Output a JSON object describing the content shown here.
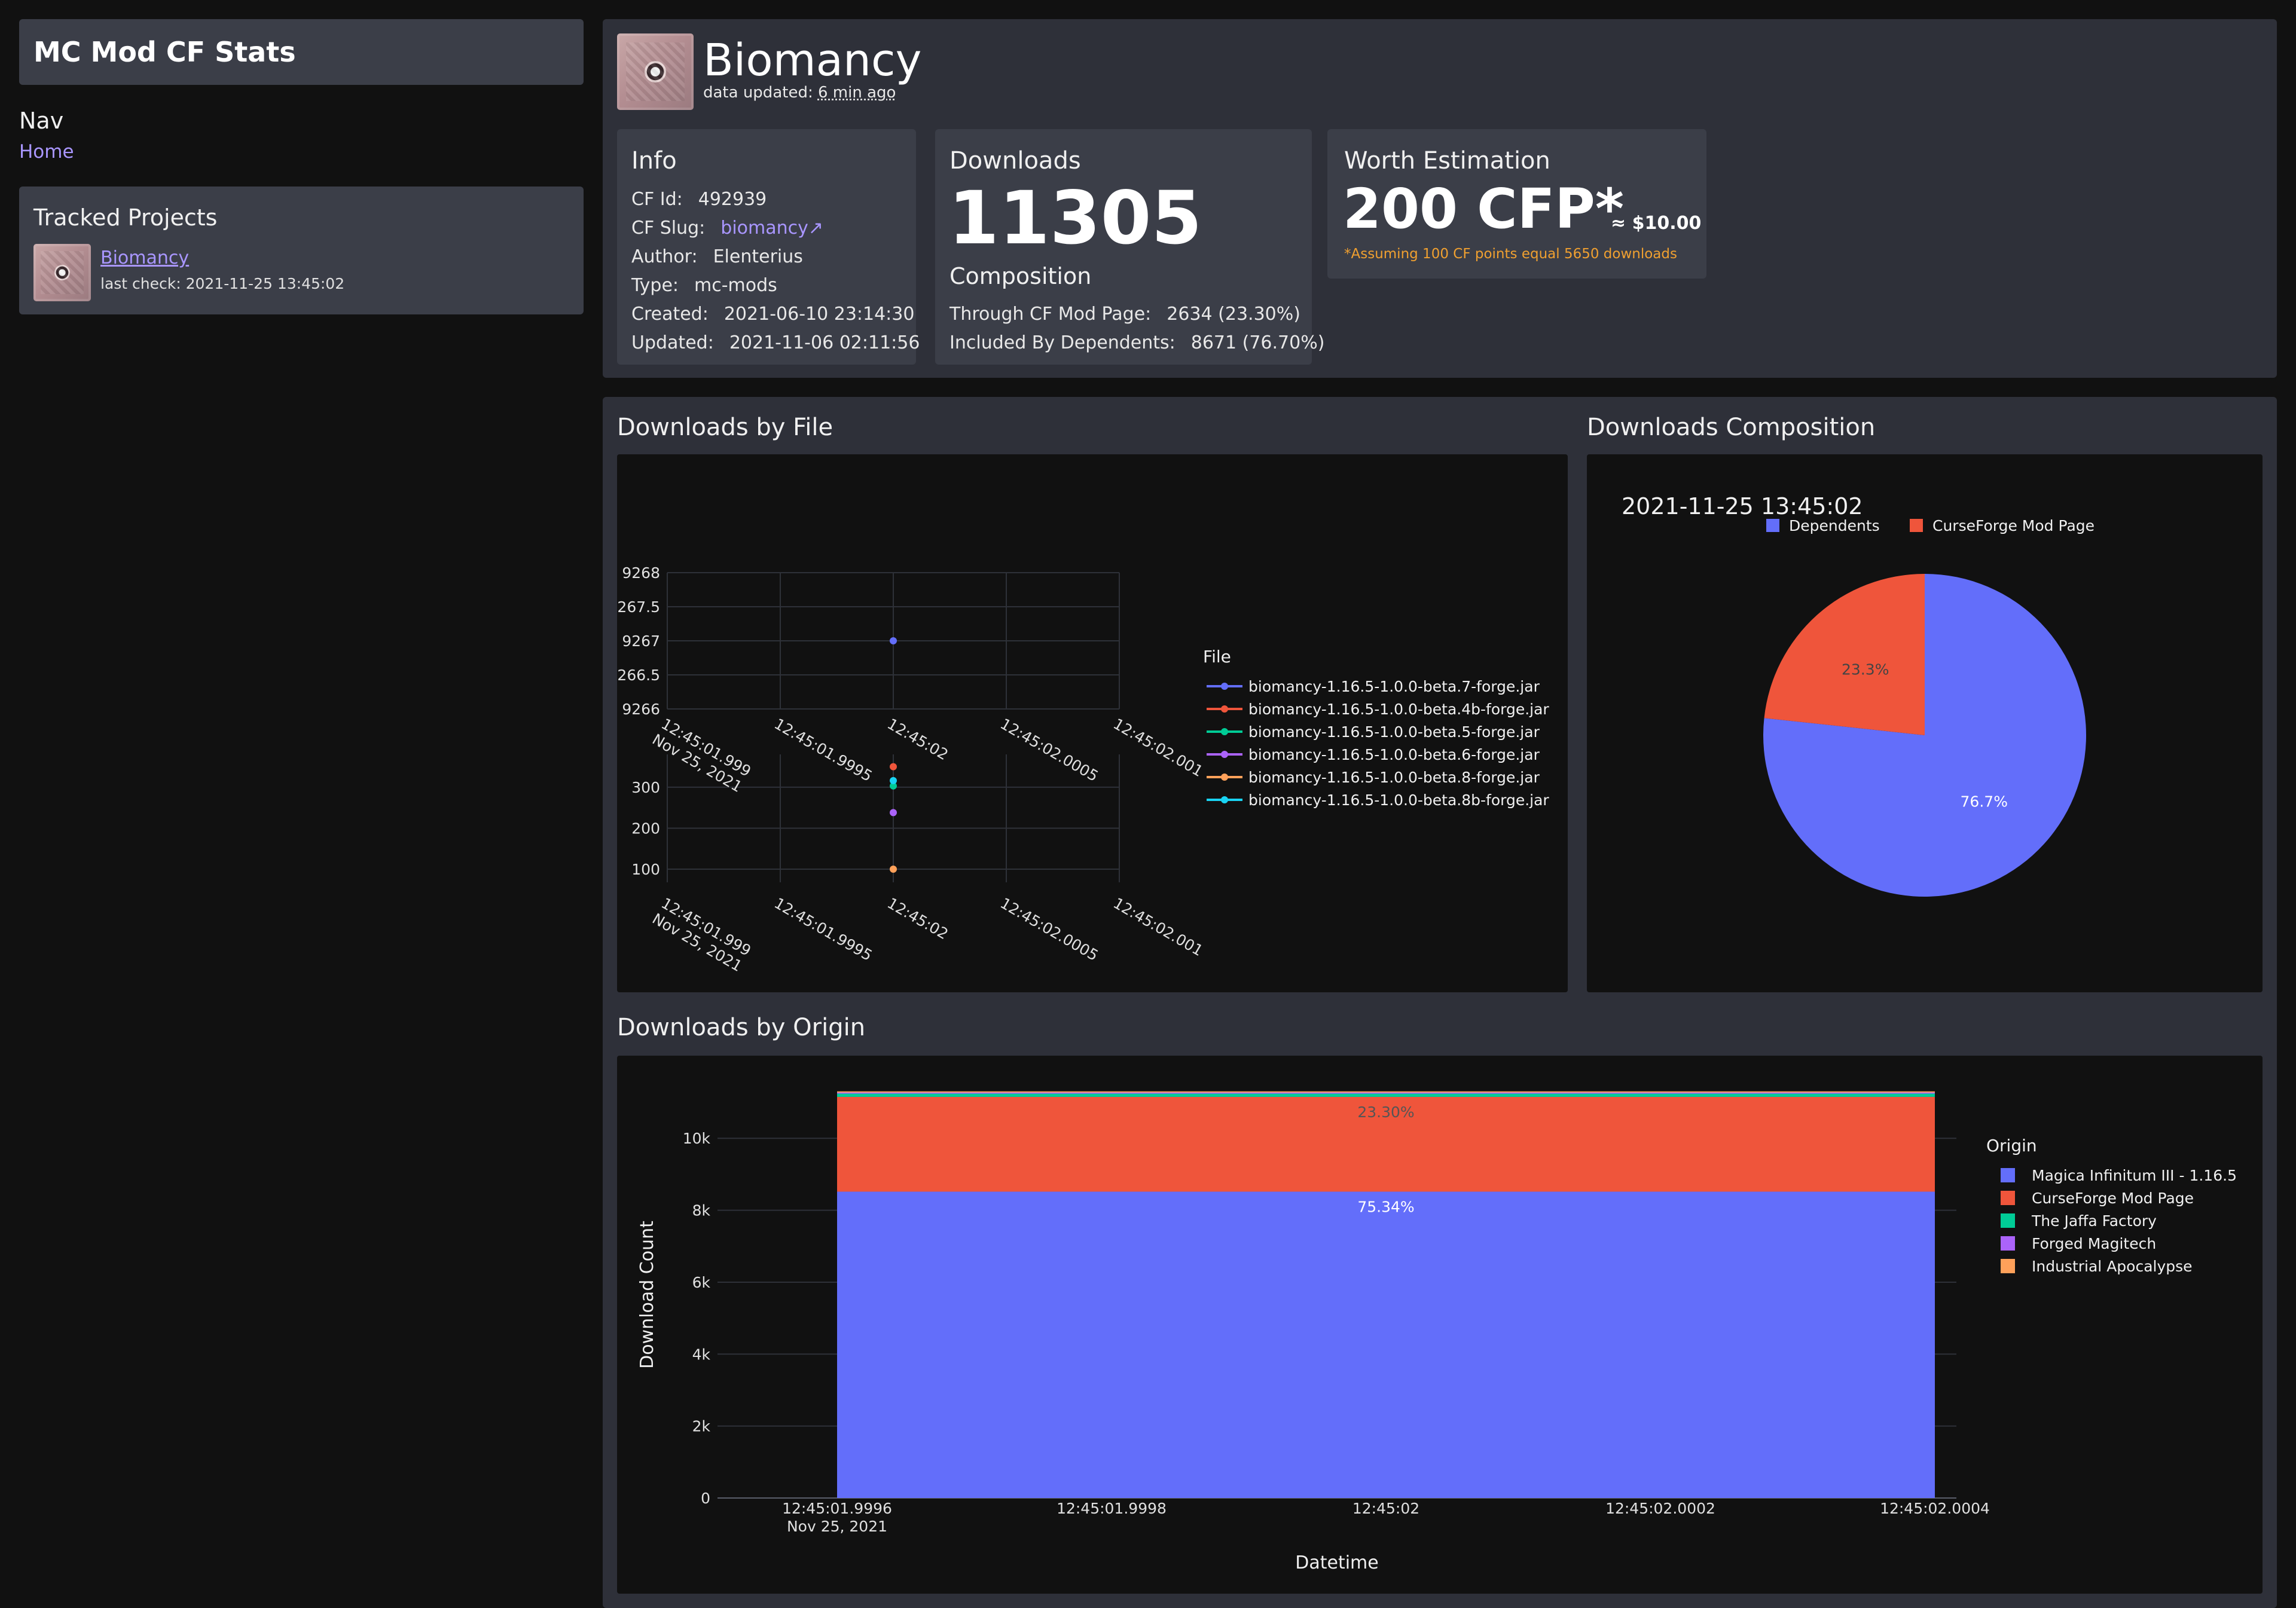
{
  "sidebar": {
    "title": "MC Mod CF Stats",
    "nav_heading": "Nav",
    "nav_home": "Home",
    "tracked_heading": "Tracked Projects",
    "tracked": [
      {
        "name": "Biomancy",
        "last_check": "last check: 2021-11-25 13:45:02"
      }
    ]
  },
  "header": {
    "title": "Biomancy",
    "updated_prefix": "data updated:",
    "updated_value": "6 min ago"
  },
  "info": {
    "heading": "Info",
    "cf_id_label": "CF Id:",
    "cf_id": "492939",
    "cf_slug_label": "CF Slug:",
    "cf_slug": "biomancy↗",
    "author_label": "Author:",
    "author": "Elenterius",
    "type_label": "Type:",
    "type": "mc-mods",
    "created_label": "Created:",
    "created": "2021-06-10 23:14:30",
    "updated_label": "Updated:",
    "updated": "2021-11-06 02:11:56"
  },
  "downloads": {
    "heading": "Downloads",
    "total": "11305",
    "composition_heading": "Composition",
    "through_label": "Through CF Mod Page:",
    "through_value": "2634 (23.30%)",
    "dependents_label": "Included By Dependents:",
    "dependents_value": "8671 (76.70%)"
  },
  "worth": {
    "heading": "Worth Estimation",
    "value": "200 CFP*",
    "usd": "≈ $10.00",
    "note": "*Assuming 100 CF points equal 5650 downloads"
  },
  "section_titles": {
    "by_file": "Downloads by File",
    "composition": "Downloads Composition",
    "by_origin": "Downloads by Origin"
  },
  "colors": {
    "blue": "#636efa",
    "red": "#ef553b",
    "green": "#00cc96",
    "purple": "#ab63fa",
    "orange": "#ffa15a",
    "cyan": "#19d3f3",
    "accent_link": "#a996ff",
    "note_orange": "#f0a030"
  },
  "chart_data": [
    {
      "type": "scatter",
      "title": "Downloads by File",
      "legend_title": "File",
      "legend_position": "right",
      "x_ticks": [
        "12:45:01.999\nNov 25, 2021",
        "12:45:01.9995",
        "12:45:02",
        "12:45:02.0005",
        "12:45:02.001"
      ],
      "upper_y_ticks": [
        "9268",
        "9,267.5",
        "9267",
        "9,266.5",
        "9266"
      ],
      "lower_y_ticks": [
        "300",
        "200",
        "100"
      ],
      "series": [
        {
          "name": "biomancy-1.16.5-1.0.0-beta.7-forge.jar",
          "x": "2021-11-25 12:45:02",
          "y": 9267
        },
        {
          "name": "biomancy-1.16.5-1.0.0-beta.4b-forge.jar",
          "x": "2021-11-25 12:45:02",
          "y": 350
        },
        {
          "name": "biomancy-1.16.5-1.0.0-beta.5-forge.jar",
          "x": "2021-11-25 12:45:02",
          "y": 303
        },
        {
          "name": "biomancy-1.16.5-1.0.0-beta.6-forge.jar",
          "x": "2021-11-25 12:45:02",
          "y": 238
        },
        {
          "name": "biomancy-1.16.5-1.0.0-beta.8-forge.jar",
          "x": "2021-11-25 12:45:02",
          "y": 100
        },
        {
          "name": "biomancy-1.16.5-1.0.0-beta.8b-forge.jar",
          "x": "2021-11-25 12:45:02",
          "y": 316
        }
      ]
    },
    {
      "type": "pie",
      "title": "2021-11-25 13:45:02",
      "legend_position": "top",
      "slices": [
        {
          "name": "Dependents",
          "value": 76.7,
          "label": "76.7%"
        },
        {
          "name": "CurseForge Mod Page",
          "value": 23.3,
          "label": "23.3%"
        }
      ]
    },
    {
      "type": "area",
      "title": "Downloads by Origin",
      "xlabel": "Datetime",
      "ylabel": "Download Count",
      "ylim": [
        0,
        11305
      ],
      "y_ticks": [
        "0",
        "2k",
        "4k",
        "6k",
        "8k",
        "10k"
      ],
      "x_ticks": [
        "12:45:01.9996\nNov 25, 2021",
        "12:45:01.9998",
        "12:45:02",
        "12:45:02.0002",
        "12:45:02.0004"
      ],
      "legend_title": "Origin",
      "legend_position": "right",
      "series": [
        {
          "name": "Magica Infinitum III - 1.16.5",
          "value": 8517,
          "label": "75.34%"
        },
        {
          "name": "CurseForge Mod Page",
          "value": 2634,
          "label": "23.30%"
        },
        {
          "name": "The Jaffa Factory",
          "value": 90
        },
        {
          "name": "Forged Magitech",
          "value": 40
        },
        {
          "name": "Industrial Apocalypse",
          "value": 24
        }
      ]
    }
  ]
}
